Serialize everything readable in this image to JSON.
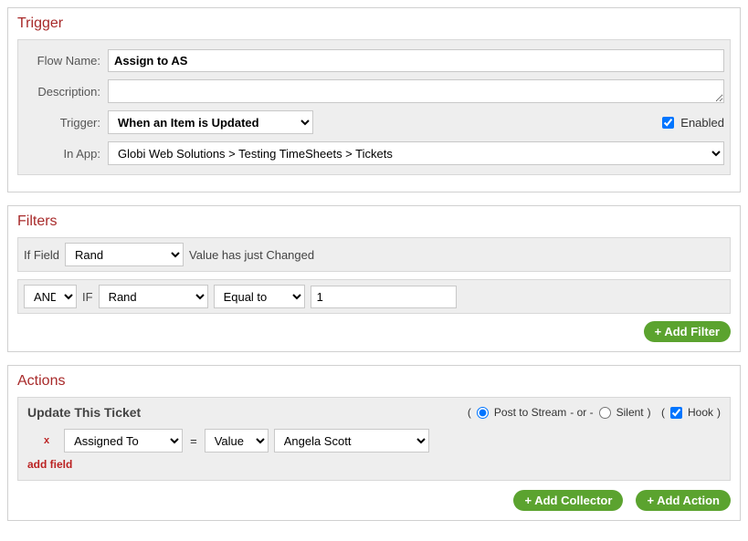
{
  "trigger": {
    "section_title": "Trigger",
    "labels": {
      "flow_name": "Flow Name:",
      "description": "Description:",
      "trigger": "Trigger:",
      "in_app": "In App:",
      "enabled": "Enabled"
    },
    "flow_name_value": "Assign to AS",
    "description_value": "",
    "trigger_value": "When an Item is Updated",
    "in_app_value": "Globi Web Solutions > Testing TimeSheets > Tickets",
    "enabled_checked": true
  },
  "filters": {
    "section_title": "Filters",
    "if_field_label": "If Field",
    "field1_value": "Rand",
    "value_changed_text": "Value has just Changed",
    "conj_value": "AND",
    "if_label": "IF",
    "field2_value": "Rand",
    "op_value": "Equal to",
    "val_value": "1",
    "add_filter": "+ Add Filter"
  },
  "actions": {
    "section_title": "Actions",
    "action_title": "Update This Ticket",
    "paren_open": "(",
    "post_label": "Post to Stream",
    "or_text": "- or -",
    "silent_label": "Silent",
    "paren_close": ")",
    "paren_open2": "(",
    "hook_label": "Hook",
    "paren_close2": ")",
    "remove_x": "x",
    "field_value": "Assigned To",
    "eq": "=",
    "mode_value": "Value",
    "person_value": "Angela Scott",
    "add_field": "add field",
    "add_collector": "+ Add Collector",
    "add_action": "+ Add Action"
  }
}
